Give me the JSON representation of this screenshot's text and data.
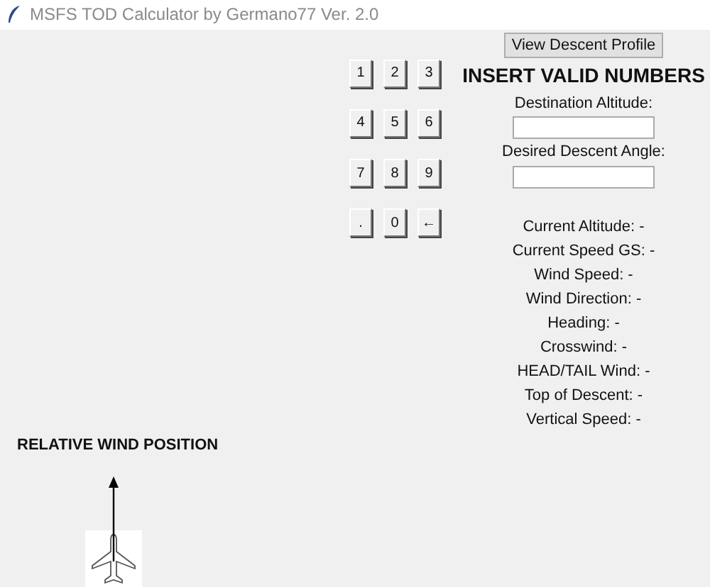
{
  "window": {
    "title": "MSFS TOD Calculator by Germano77 Ver. 2.0"
  },
  "keypad": [
    "1",
    "2",
    "3",
    "4",
    "5",
    "6",
    "7",
    "8",
    "9",
    ".",
    "0",
    "←"
  ],
  "view_button": "View Descent Profile",
  "heading": "INSERT VALID NUMBERS",
  "fields": [
    {
      "label": "Destination Altitude:"
    },
    {
      "label": "Desired Descent Angle:"
    }
  ],
  "readouts": [
    "Current Altitude: -",
    "Current Speed GS: -",
    "Wind Speed: -",
    "Wind Direction: -",
    "Heading: -",
    "Crosswind: -",
    "HEAD/TAIL Wind: -",
    "Top of Descent: -",
    "Vertical Speed: -"
  ],
  "wind_panel": {
    "title": "RELATIVE WIND POSITION"
  }
}
